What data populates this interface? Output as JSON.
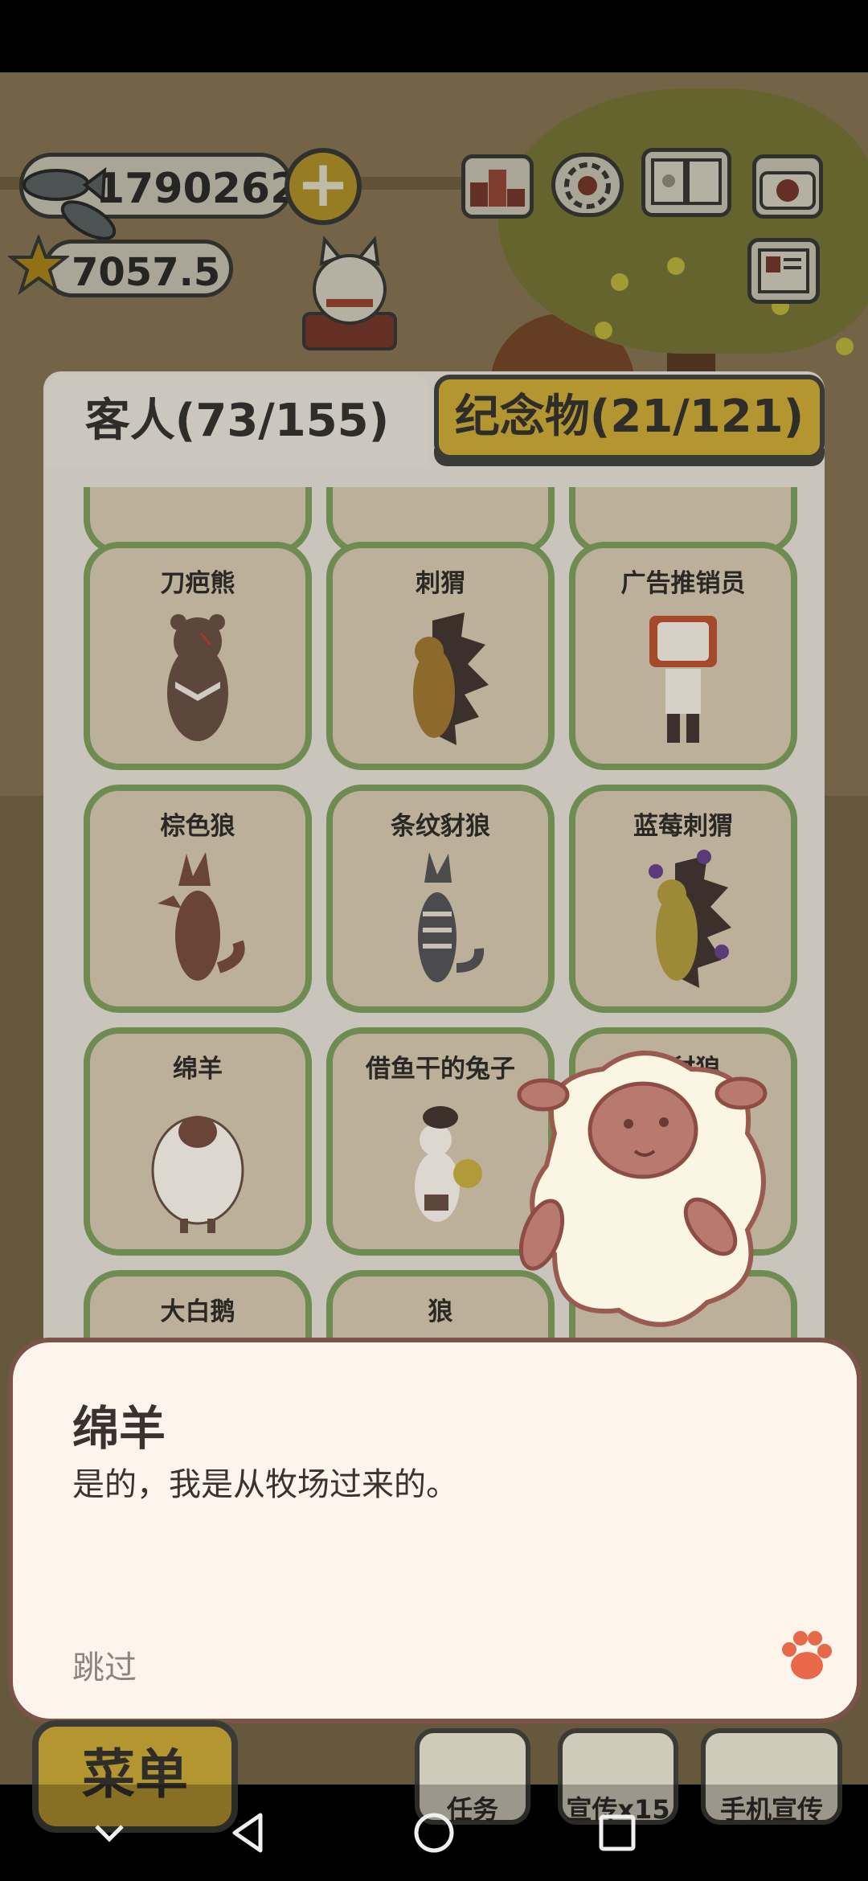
{
  "hud": {
    "fish_count": "1790262",
    "star_count": "7057.5",
    "plus_label": "+"
  },
  "tabs": {
    "guests": "客人(73/155)",
    "souvenirs": "纪念物(21/121)"
  },
  "guests": [
    {
      "name": "刀疤熊",
      "icon": "scarred-bear"
    },
    {
      "name": "刺猬",
      "icon": "hedgehog"
    },
    {
      "name": "广告推销员",
      "icon": "tv-head-salesman"
    },
    {
      "name": "棕色狼",
      "icon": "brown-wolf"
    },
    {
      "name": "条纹豺狼",
      "icon": "striped-jackal"
    },
    {
      "name": "蓝莓刺猬",
      "icon": "blueberry-hedgehog"
    },
    {
      "name": "绵羊",
      "icon": "sheep"
    },
    {
      "name": "借鱼干的兔子",
      "icon": "rabbit"
    },
    {
      "name": "黄豺狼",
      "icon": "jackal"
    },
    {
      "name": "大白鹅",
      "icon": "goose"
    },
    {
      "name": "狼",
      "icon": "wolf"
    }
  ],
  "dialog": {
    "speaker": "绵羊",
    "text": "是的，我是从牧场过来的。",
    "skip": "跳过"
  },
  "menu": {
    "main": "菜单",
    "tasks": "任务",
    "promote": "宣传x15",
    "phone_promote": "手机宣传"
  },
  "colors": {
    "card_border": "#6e8c52",
    "tab_gold": "#b49631",
    "dialog_bg": "#fdf5ec",
    "paw": "#e8684a"
  }
}
